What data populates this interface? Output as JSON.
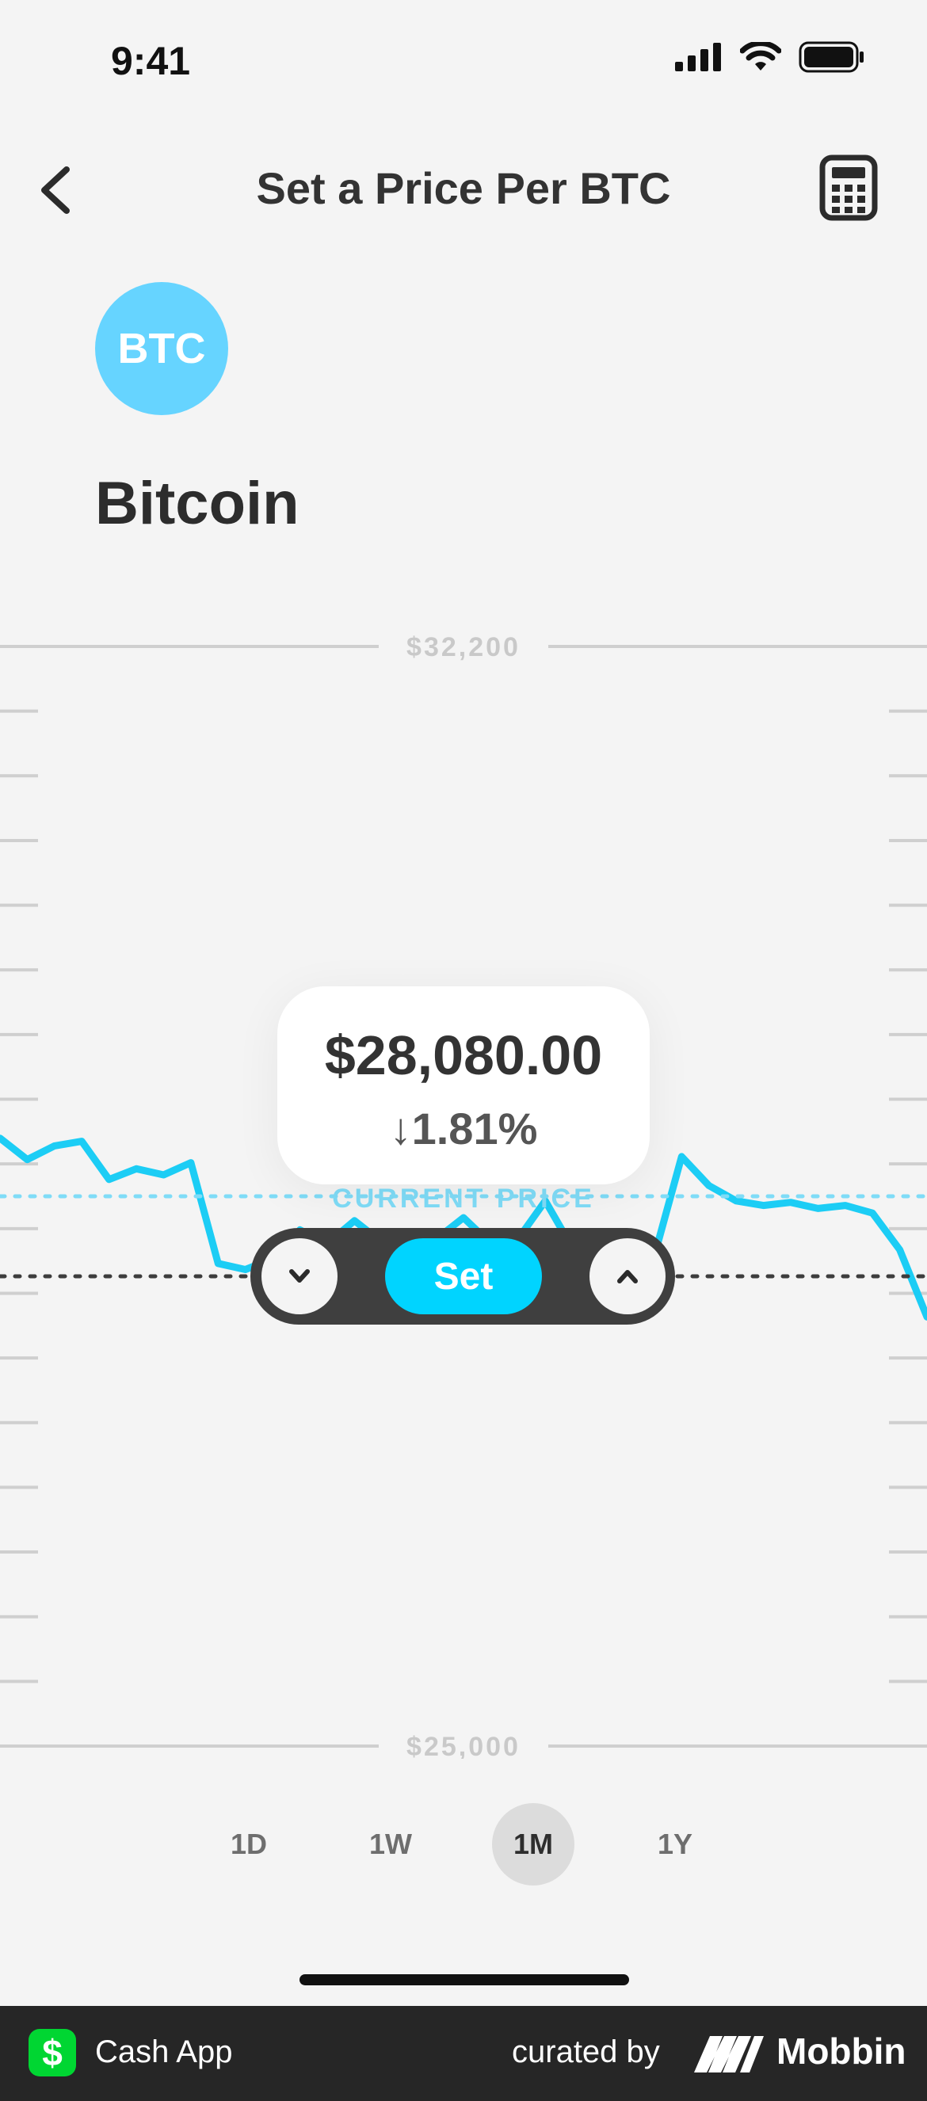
{
  "status_bar": {
    "time": "9:41"
  },
  "nav": {
    "title": "Set a Price Per BTC"
  },
  "asset": {
    "ticker": "BTC",
    "name": "Bitcoin",
    "badge_color": "#66d4ff"
  },
  "chart_data": {
    "type": "line",
    "ylim": [
      25000,
      32200
    ],
    "y_ticks": [
      "$32,200",
      "$25,000"
    ],
    "current_price_label": "CURRENT PRICE",
    "current_price": 28080,
    "series": [
      {
        "values": [
          28980,
          28840,
          28930,
          28960,
          28710,
          28780,
          28740,
          28820,
          28160,
          28120,
          28190,
          28380,
          28290,
          28440,
          28300,
          28310,
          28320,
          28460,
          28290,
          28320,
          28570,
          28260,
          28260,
          28270,
          28210,
          28860,
          28670,
          28570,
          28540,
          28560,
          28520,
          28540,
          28490,
          28250,
          27810
        ]
      }
    ]
  },
  "tooltip": {
    "price": "$28,080.00",
    "change_arrow": "↓",
    "change": "1.81%"
  },
  "controls": {
    "set_label": "Set"
  },
  "range_tabs": [
    {
      "label": "1D"
    },
    {
      "label": "1W"
    },
    {
      "label": "1M"
    },
    {
      "label": "1Y"
    }
  ],
  "footer": {
    "app_name": "Cash App",
    "curated_by": "curated by",
    "brand": "Mobbin"
  },
  "colors": {
    "accent": "#00d4ff",
    "line": "#1ccdf5",
    "cash_green": "#00d632"
  }
}
